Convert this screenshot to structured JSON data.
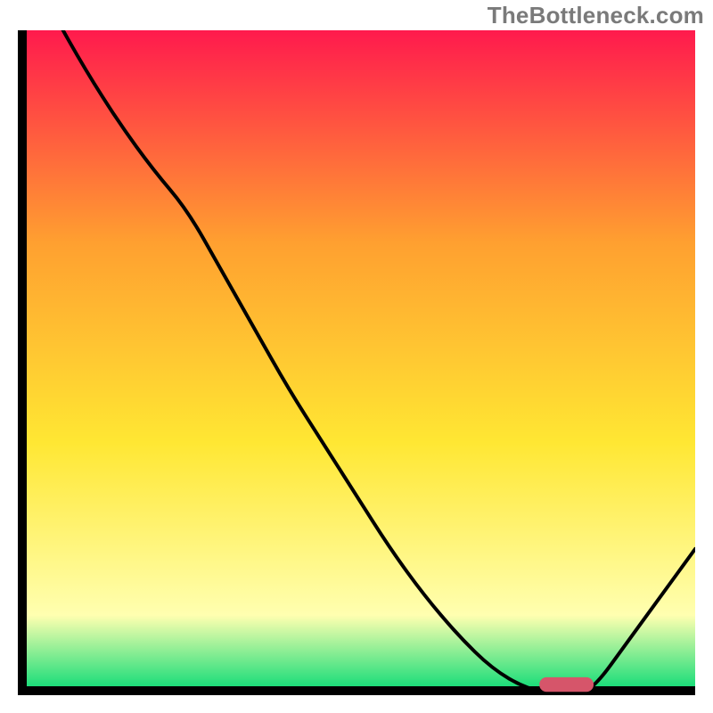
{
  "watermark": "TheBottleneck.com",
  "chart_data": {
    "type": "line",
    "title": "",
    "xlabel": "",
    "ylabel": "",
    "xlim": [
      0,
      100
    ],
    "ylim": [
      0,
      100
    ],
    "grid": false,
    "legend": false,
    "background_gradient": {
      "top": "#ff1a4d",
      "mid_upper": "#ffa030",
      "mid": "#ffe733",
      "mid_lower": "#ffffb0",
      "bottom": "#00d973"
    },
    "series": [
      {
        "name": "bottleneck-curve",
        "color": "#000000",
        "x": [
          0,
          5,
          10,
          15,
          20,
          25,
          30,
          35,
          40,
          45,
          50,
          55,
          60,
          65,
          70,
          75,
          80,
          82,
          85,
          90,
          95,
          100
        ],
        "y": [
          113,
          103,
          94,
          86,
          79,
          73,
          64,
          55,
          46,
          38,
          30,
          22,
          15,
          9,
          4,
          1,
          0,
          0,
          1,
          8,
          15,
          22
        ]
      }
    ],
    "markers": [
      {
        "name": "optimal-range",
        "shape": "rounded-rect",
        "color": "#d6556a",
        "x_start": 77,
        "x_end": 85,
        "y": 0.5,
        "height": 2.2
      }
    ]
  }
}
